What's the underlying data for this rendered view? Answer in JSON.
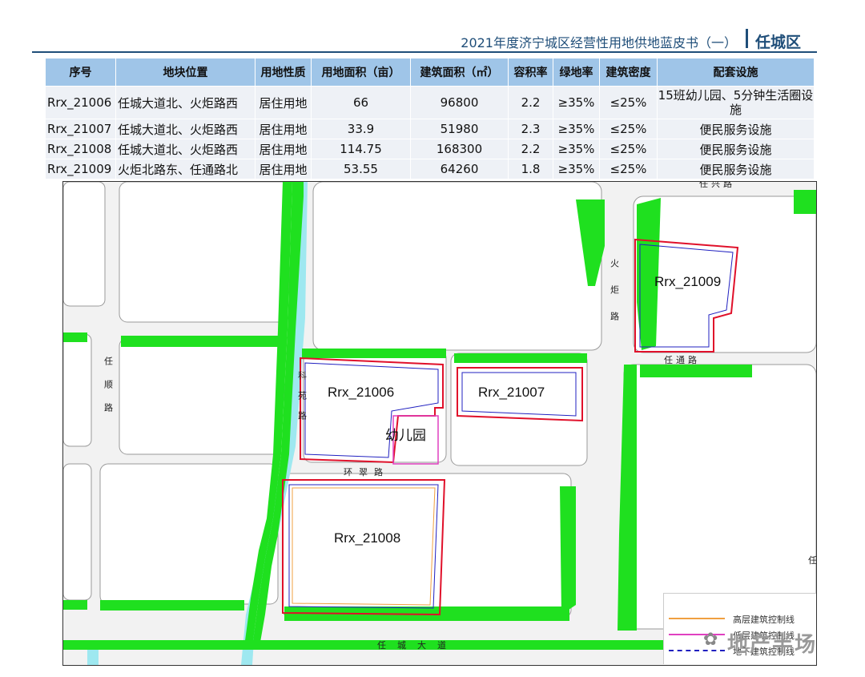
{
  "header": {
    "title": "2021年度济宁城区经营性用地供地蓝皮书（一）",
    "district": "任城区"
  },
  "table": {
    "headers": [
      "序号",
      "地块位置",
      "用地性质",
      "用地面积（亩）",
      "建筑面积（㎡）",
      "容积率",
      "绿地率",
      "建筑密度",
      "配套设施"
    ],
    "rows": [
      [
        "Rrx_21006",
        "任城大道北、火炬路西",
        "居住用地",
        "66",
        "96800",
        "2.2",
        "≥35%",
        "≤25%",
        "15班幼儿园、5分钟生活圈设施"
      ],
      [
        "Rrx_21007",
        "任城大道北、火炬路西",
        "居住用地",
        "33.9",
        "51980",
        "2.3",
        "≥35%",
        "≤25%",
        "便民服务设施"
      ],
      [
        "Rrx_21008",
        "任城大道北、火炬路西",
        "居住用地",
        "114.75",
        "168300",
        "2.2",
        "≥35%",
        "≤25%",
        "便民服务设施"
      ],
      [
        "Rrx_21009",
        "火炬北路东、任通路北",
        "居住用地",
        "53.55",
        "64260",
        "1.8",
        "≥35%",
        "≤25%",
        "便民服务设施"
      ]
    ]
  },
  "map": {
    "parcels": [
      "Rrx_21006",
      "Rrx_21007",
      "Rrx_21008",
      "Rrx_21009"
    ],
    "kindergarten": "幼儿园",
    "roads": {
      "renshun": "任顺路",
      "keyuan": "科苑路",
      "huancui": "环翠路",
      "huoju": "火炬路",
      "rentong": "任通路",
      "rencheng": "任城大道",
      "top_right": "任兴路",
      "edge_right": "任"
    },
    "colors": {
      "green": "#1fe01f",
      "river": "#9ee8f0",
      "road": "#ffffff",
      "block": "#ffffff",
      "boundary": "#e0102a"
    }
  },
  "legend": {
    "items": [
      {
        "label": "高层建筑控制线",
        "color": "#f0a040"
      },
      {
        "label": "低层建筑控制线",
        "color": "#e040c0"
      },
      {
        "label": "地下建筑控制线",
        "color": "#2020c0"
      }
    ]
  },
  "watermark": {
    "text": "地产半场"
  }
}
